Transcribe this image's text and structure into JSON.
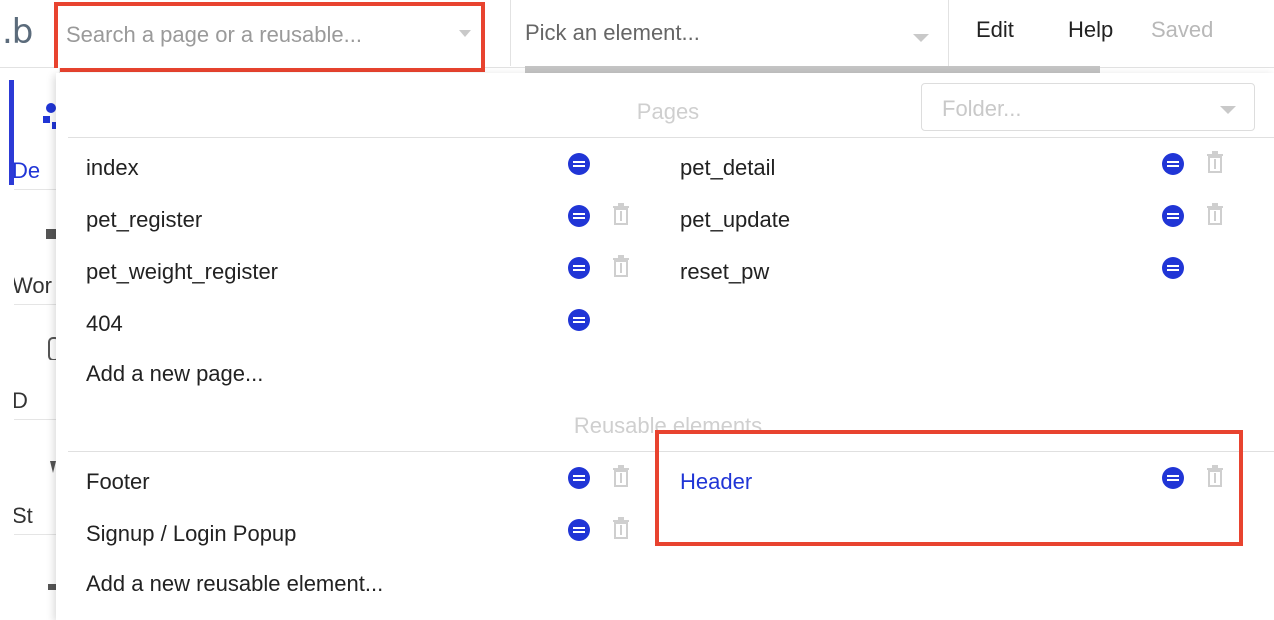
{
  "logo": {
    "text": ".b"
  },
  "search": {
    "placeholder": "Search a page or a reusable..."
  },
  "element_picker": {
    "label": "Pick an element..."
  },
  "menu": {
    "edit": "Edit",
    "help": "Help",
    "saved": "Saved"
  },
  "sidebar": {
    "items": [
      {
        "label": "De"
      },
      {
        "label": "Wor"
      },
      {
        "label": "D"
      },
      {
        "label": "St"
      }
    ]
  },
  "panel": {
    "folder_placeholder": "Folder...",
    "pages_heading": "Pages",
    "reusable_heading": "Reusable elements",
    "pages": [
      {
        "name": "index",
        "has_trash": false
      },
      {
        "name": "pet_detail",
        "has_trash": true
      },
      {
        "name": "pet_register",
        "has_trash": true
      },
      {
        "name": "pet_update",
        "has_trash": true
      },
      {
        "name": "pet_weight_register",
        "has_trash": true
      },
      {
        "name": "reset_pw",
        "has_trash": false
      },
      {
        "name": "404",
        "has_trash": false
      }
    ],
    "add_page": "Add a new page...",
    "reusables": [
      {
        "name": "Footer",
        "has_trash": true
      },
      {
        "name": "Header",
        "has_trash": true,
        "selected": true
      },
      {
        "name": "Signup / Login Popup",
        "has_trash": true
      }
    ],
    "add_reusable": "Add a new reusable element..."
  },
  "colors": {
    "accent_blue": "#2035d6",
    "highlight_red": "#e8432f"
  }
}
